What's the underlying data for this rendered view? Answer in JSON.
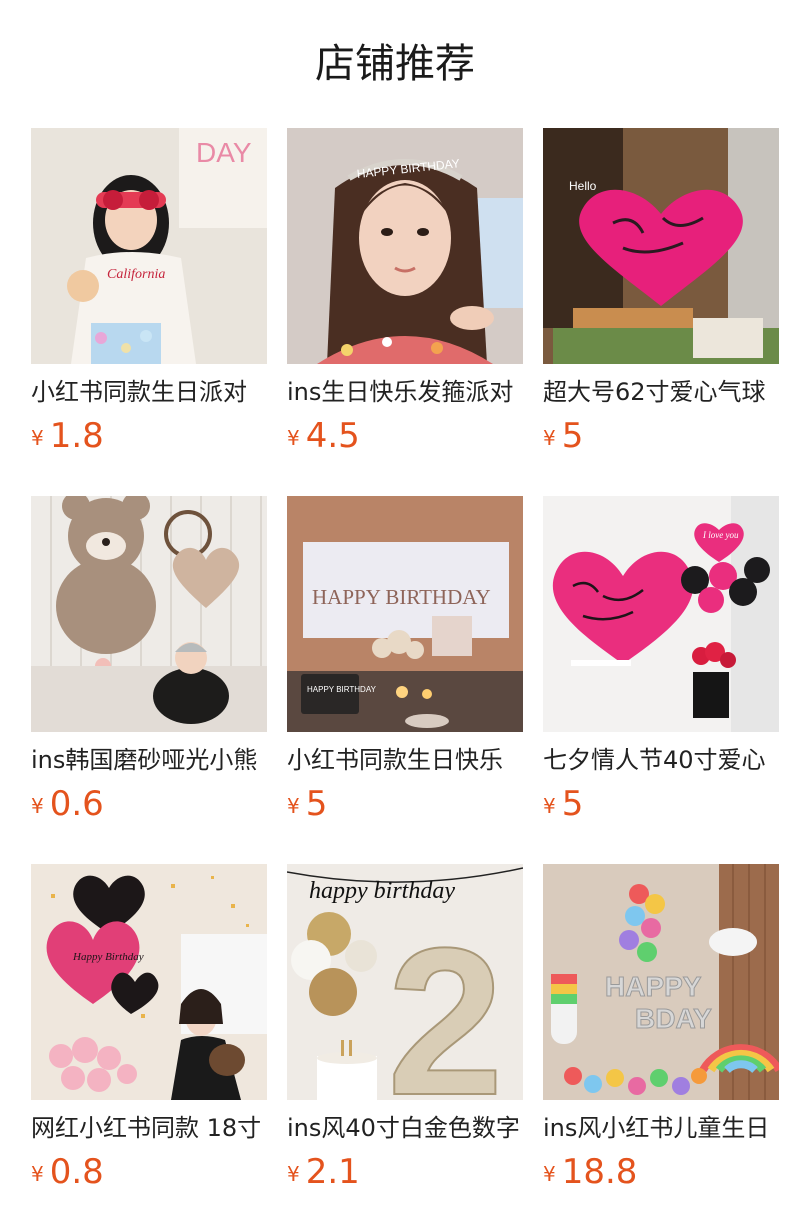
{
  "header": {
    "title": "店铺推荐"
  },
  "currency_symbol": "¥",
  "products": [
    {
      "name": "小红书同款生日派对",
      "price": "1.8"
    },
    {
      "name": "ins生日快乐发箍派对",
      "price": "4.5"
    },
    {
      "name": "超大号62寸爱心气球",
      "price": "5"
    },
    {
      "name": "ins韩国磨砂哑光小熊",
      "price": "0.6"
    },
    {
      "name": "小红书同款生日快乐",
      "price": "5"
    },
    {
      "name": "七夕情人节40寸爱心",
      "price": "5"
    },
    {
      "name": "网红小红书同款 18寸",
      "price": "0.8"
    },
    {
      "name": "ins风40寸白金色数字",
      "price": "2.1"
    },
    {
      "name": "ins风小红书儿童生日",
      "price": "18.8"
    }
  ],
  "image_text": {
    "banner_day": "DAY",
    "shirt_text": "California",
    "headband_text": "HAPPY BIRTHDAY",
    "hello_sign": "Hello",
    "projector_text": "HAPPY BIRTHDAY",
    "laptop_text": "HAPPY BIRTHDAY",
    "balloon_love": "I love you",
    "heart_happy": "Happy Birthday",
    "garland_text": "happy birthday",
    "number_balloon": "2",
    "balloon_happy": "HAPPY",
    "balloon_bday": "BDAY"
  }
}
